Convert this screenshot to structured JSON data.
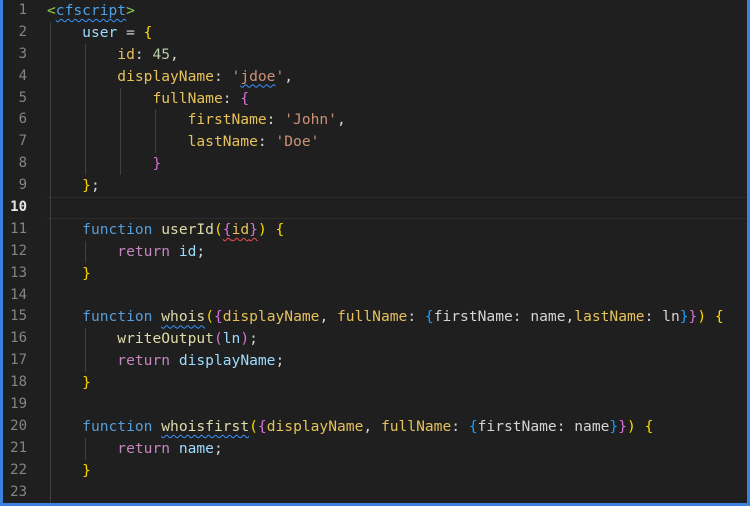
{
  "editor": {
    "current_line": 10,
    "line_numbers": [
      "1",
      "2",
      "3",
      "4",
      "5",
      "6",
      "7",
      "8",
      "9",
      "10",
      "11",
      "12",
      "13",
      "14",
      "15",
      "16",
      "17",
      "18",
      "19",
      "20",
      "21",
      "22",
      "23"
    ],
    "colors": {
      "border": "#3b82e0",
      "background": "#1f1f1f",
      "keyword": "#569cd6",
      "string": "#ce9178",
      "number": "#b5cea8",
      "error_squiggle": "#f14c4c",
      "info_squiggle": "#3794ff"
    },
    "lines": [
      [
        [
          "<",
          "tagp"
        ],
        [
          "cfscript",
          "tag",
          "info"
        ],
        [
          ">",
          "tagp"
        ]
      ],
      [
        [
          "    ",
          "plain"
        ],
        [
          "user",
          "var"
        ],
        [
          " = ",
          "p"
        ],
        [
          "{",
          "b1"
        ]
      ],
      [
        [
          "        ",
          "plain"
        ],
        [
          "id",
          "prop"
        ],
        [
          ": ",
          "p"
        ],
        [
          "45",
          "num"
        ],
        [
          ",",
          "p"
        ]
      ],
      [
        [
          "        ",
          "plain"
        ],
        [
          "displayName",
          "prop"
        ],
        [
          ": ",
          "p"
        ],
        [
          "'",
          "str"
        ],
        [
          "jdoe",
          "str",
          "info"
        ],
        [
          "'",
          "str"
        ],
        [
          ",",
          "p"
        ]
      ],
      [
        [
          "            ",
          "plain"
        ],
        [
          "fullName",
          "prop"
        ],
        [
          ": ",
          "p"
        ],
        [
          "{",
          "b2"
        ]
      ],
      [
        [
          "                ",
          "plain"
        ],
        [
          "firstName",
          "prop"
        ],
        [
          ": ",
          "p"
        ],
        [
          "'John'",
          "str"
        ],
        [
          ",",
          "p"
        ]
      ],
      [
        [
          "                ",
          "plain"
        ],
        [
          "lastName",
          "prop"
        ],
        [
          ": ",
          "p"
        ],
        [
          "'Doe'",
          "str"
        ]
      ],
      [
        [
          "            ",
          "plain"
        ],
        [
          "}",
          "b2"
        ]
      ],
      [
        [
          "    ",
          "plain"
        ],
        [
          "}",
          "b1"
        ],
        [
          ";",
          "p"
        ]
      ],
      [],
      [
        [
          "    ",
          "plain"
        ],
        [
          "function",
          "kw"
        ],
        [
          " ",
          "plain"
        ],
        [
          "userId",
          "fn"
        ],
        [
          "(",
          "b1"
        ],
        [
          "{",
          "b2",
          "err"
        ],
        [
          "id",
          "prop",
          "err"
        ],
        [
          "}",
          "b2",
          "err"
        ],
        [
          ")",
          "b1"
        ],
        [
          " ",
          "plain"
        ],
        [
          "{",
          "b1"
        ]
      ],
      [
        [
          "        ",
          "plain"
        ],
        [
          "return",
          "ret"
        ],
        [
          " ",
          "plain"
        ],
        [
          "id",
          "var"
        ],
        [
          ";",
          "p"
        ]
      ],
      [
        [
          "    ",
          "plain"
        ],
        [
          "}",
          "b1"
        ]
      ],
      [],
      [
        [
          "    ",
          "plain"
        ],
        [
          "function",
          "kw"
        ],
        [
          " ",
          "plain"
        ],
        [
          "whois",
          "fn",
          "info"
        ],
        [
          "(",
          "b1"
        ],
        [
          "{",
          "b2"
        ],
        [
          "displayName",
          "prop"
        ],
        [
          ", ",
          "p"
        ],
        [
          "fullName",
          "prop"
        ],
        [
          ": ",
          "p"
        ],
        [
          "{",
          "b3"
        ],
        [
          "firstName: name,",
          "plain"
        ],
        [
          "lastName",
          "prop"
        ],
        [
          ": ",
          "p"
        ],
        [
          "ln",
          "plain"
        ],
        [
          "}",
          "b3"
        ],
        [
          "}",
          "b2"
        ],
        [
          ")",
          "b1"
        ],
        [
          " ",
          "plain"
        ],
        [
          "{",
          "b1"
        ]
      ],
      [
        [
          "        ",
          "plain"
        ],
        [
          "writeOutput",
          "fn"
        ],
        [
          "(",
          "b2"
        ],
        [
          "ln",
          "var"
        ],
        [
          ")",
          "b2"
        ],
        [
          ";",
          "p"
        ]
      ],
      [
        [
          "        ",
          "plain"
        ],
        [
          "return",
          "ret"
        ],
        [
          " ",
          "plain"
        ],
        [
          "displayName",
          "var"
        ],
        [
          ";",
          "p"
        ]
      ],
      [
        [
          "    ",
          "plain"
        ],
        [
          "}",
          "b1"
        ]
      ],
      [],
      [
        [
          "    ",
          "plain"
        ],
        [
          "function",
          "kw"
        ],
        [
          " ",
          "plain"
        ],
        [
          "whoisfirst",
          "fn",
          "info"
        ],
        [
          "(",
          "b1"
        ],
        [
          "{",
          "b2"
        ],
        [
          "displayName",
          "prop"
        ],
        [
          ", ",
          "p"
        ],
        [
          "fullName",
          "prop"
        ],
        [
          ": ",
          "p"
        ],
        [
          "{",
          "b3"
        ],
        [
          "firstName: name",
          "plain"
        ],
        [
          "}",
          "b3"
        ],
        [
          "}",
          "b2"
        ],
        [
          ")",
          "b1"
        ],
        [
          " ",
          "plain"
        ],
        [
          "{",
          "b1"
        ]
      ],
      [
        [
          "        ",
          "plain"
        ],
        [
          "return",
          "ret"
        ],
        [
          " ",
          "plain"
        ],
        [
          "name",
          "var"
        ],
        [
          ";",
          "p"
        ]
      ],
      [
        [
          "    ",
          "plain"
        ],
        [
          "}",
          "b1"
        ]
      ],
      []
    ]
  }
}
